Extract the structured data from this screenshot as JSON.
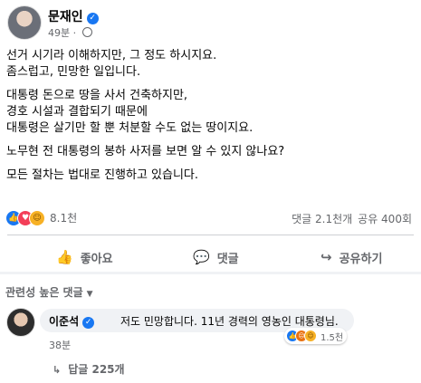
{
  "post": {
    "author": "문재인",
    "time": "49분",
    "lines": [
      "선거 시기라 이해하지만, 그 정도 하시지요.",
      "좀스럽고, 민망한 일입니다.",
      "대통령 돈으로 땅을 사서 건축하지만,",
      "경호 시설과 결합되기 때문에",
      "대통령은 살기만 할 뿐 처분할 수도 없는 땅이지요.",
      "노무현 전 대통령의 봉하 사저를 보면 알 수 있지 않나요?",
      "모든 절차는 법대로 진행하고 있습니다."
    ],
    "reactions": {
      "count": "8.1천",
      "icons": [
        "like-icon",
        "love-icon",
        "haha-icon"
      ]
    },
    "stats": {
      "comments": "댓글 2.1천개",
      "shares": "공유 400회"
    }
  },
  "actions": {
    "like": "좋아요",
    "comment": "댓글",
    "share": "공유하기"
  },
  "comments_filter": "관련성 높은 댓글",
  "comment": {
    "author": "이준석",
    "text": "저도 민망합니다. 11년 경력의 영농인 대통령님.",
    "time": "38분",
    "reaction_count": "1.5천",
    "replies": "답글 225개"
  },
  "colors": {
    "accent": "#1877f2",
    "secondary_text": "#65676b",
    "divider": "#ced0d4"
  }
}
